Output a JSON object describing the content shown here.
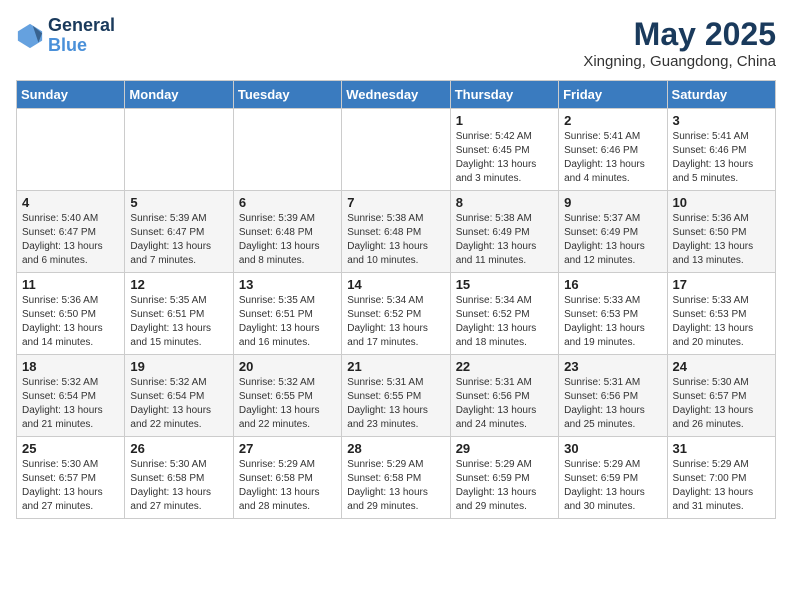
{
  "header": {
    "logo_line1": "General",
    "logo_line2": "Blue",
    "month_year": "May 2025",
    "location": "Xingning, Guangdong, China"
  },
  "weekdays": [
    "Sunday",
    "Monday",
    "Tuesday",
    "Wednesday",
    "Thursday",
    "Friday",
    "Saturday"
  ],
  "weeks": [
    [
      {
        "day": "",
        "info": ""
      },
      {
        "day": "",
        "info": ""
      },
      {
        "day": "",
        "info": ""
      },
      {
        "day": "",
        "info": ""
      },
      {
        "day": "1",
        "info": "Sunrise: 5:42 AM\nSunset: 6:45 PM\nDaylight: 13 hours\nand 3 minutes."
      },
      {
        "day": "2",
        "info": "Sunrise: 5:41 AM\nSunset: 6:46 PM\nDaylight: 13 hours\nand 4 minutes."
      },
      {
        "day": "3",
        "info": "Sunrise: 5:41 AM\nSunset: 6:46 PM\nDaylight: 13 hours\nand 5 minutes."
      }
    ],
    [
      {
        "day": "4",
        "info": "Sunrise: 5:40 AM\nSunset: 6:47 PM\nDaylight: 13 hours\nand 6 minutes."
      },
      {
        "day": "5",
        "info": "Sunrise: 5:39 AM\nSunset: 6:47 PM\nDaylight: 13 hours\nand 7 minutes."
      },
      {
        "day": "6",
        "info": "Sunrise: 5:39 AM\nSunset: 6:48 PM\nDaylight: 13 hours\nand 8 minutes."
      },
      {
        "day": "7",
        "info": "Sunrise: 5:38 AM\nSunset: 6:48 PM\nDaylight: 13 hours\nand 10 minutes."
      },
      {
        "day": "8",
        "info": "Sunrise: 5:38 AM\nSunset: 6:49 PM\nDaylight: 13 hours\nand 11 minutes."
      },
      {
        "day": "9",
        "info": "Sunrise: 5:37 AM\nSunset: 6:49 PM\nDaylight: 13 hours\nand 12 minutes."
      },
      {
        "day": "10",
        "info": "Sunrise: 5:36 AM\nSunset: 6:50 PM\nDaylight: 13 hours\nand 13 minutes."
      }
    ],
    [
      {
        "day": "11",
        "info": "Sunrise: 5:36 AM\nSunset: 6:50 PM\nDaylight: 13 hours\nand 14 minutes."
      },
      {
        "day": "12",
        "info": "Sunrise: 5:35 AM\nSunset: 6:51 PM\nDaylight: 13 hours\nand 15 minutes."
      },
      {
        "day": "13",
        "info": "Sunrise: 5:35 AM\nSunset: 6:51 PM\nDaylight: 13 hours\nand 16 minutes."
      },
      {
        "day": "14",
        "info": "Sunrise: 5:34 AM\nSunset: 6:52 PM\nDaylight: 13 hours\nand 17 minutes."
      },
      {
        "day": "15",
        "info": "Sunrise: 5:34 AM\nSunset: 6:52 PM\nDaylight: 13 hours\nand 18 minutes."
      },
      {
        "day": "16",
        "info": "Sunrise: 5:33 AM\nSunset: 6:53 PM\nDaylight: 13 hours\nand 19 minutes."
      },
      {
        "day": "17",
        "info": "Sunrise: 5:33 AM\nSunset: 6:53 PM\nDaylight: 13 hours\nand 20 minutes."
      }
    ],
    [
      {
        "day": "18",
        "info": "Sunrise: 5:32 AM\nSunset: 6:54 PM\nDaylight: 13 hours\nand 21 minutes."
      },
      {
        "day": "19",
        "info": "Sunrise: 5:32 AM\nSunset: 6:54 PM\nDaylight: 13 hours\nand 22 minutes."
      },
      {
        "day": "20",
        "info": "Sunrise: 5:32 AM\nSunset: 6:55 PM\nDaylight: 13 hours\nand 22 minutes."
      },
      {
        "day": "21",
        "info": "Sunrise: 5:31 AM\nSunset: 6:55 PM\nDaylight: 13 hours\nand 23 minutes."
      },
      {
        "day": "22",
        "info": "Sunrise: 5:31 AM\nSunset: 6:56 PM\nDaylight: 13 hours\nand 24 minutes."
      },
      {
        "day": "23",
        "info": "Sunrise: 5:31 AM\nSunset: 6:56 PM\nDaylight: 13 hours\nand 25 minutes."
      },
      {
        "day": "24",
        "info": "Sunrise: 5:30 AM\nSunset: 6:57 PM\nDaylight: 13 hours\nand 26 minutes."
      }
    ],
    [
      {
        "day": "25",
        "info": "Sunrise: 5:30 AM\nSunset: 6:57 PM\nDaylight: 13 hours\nand 27 minutes."
      },
      {
        "day": "26",
        "info": "Sunrise: 5:30 AM\nSunset: 6:58 PM\nDaylight: 13 hours\nand 27 minutes."
      },
      {
        "day": "27",
        "info": "Sunrise: 5:29 AM\nSunset: 6:58 PM\nDaylight: 13 hours\nand 28 minutes."
      },
      {
        "day": "28",
        "info": "Sunrise: 5:29 AM\nSunset: 6:58 PM\nDaylight: 13 hours\nand 29 minutes."
      },
      {
        "day": "29",
        "info": "Sunrise: 5:29 AM\nSunset: 6:59 PM\nDaylight: 13 hours\nand 29 minutes."
      },
      {
        "day": "30",
        "info": "Sunrise: 5:29 AM\nSunset: 6:59 PM\nDaylight: 13 hours\nand 30 minutes."
      },
      {
        "day": "31",
        "info": "Sunrise: 5:29 AM\nSunset: 7:00 PM\nDaylight: 13 hours\nand 31 minutes."
      }
    ]
  ]
}
